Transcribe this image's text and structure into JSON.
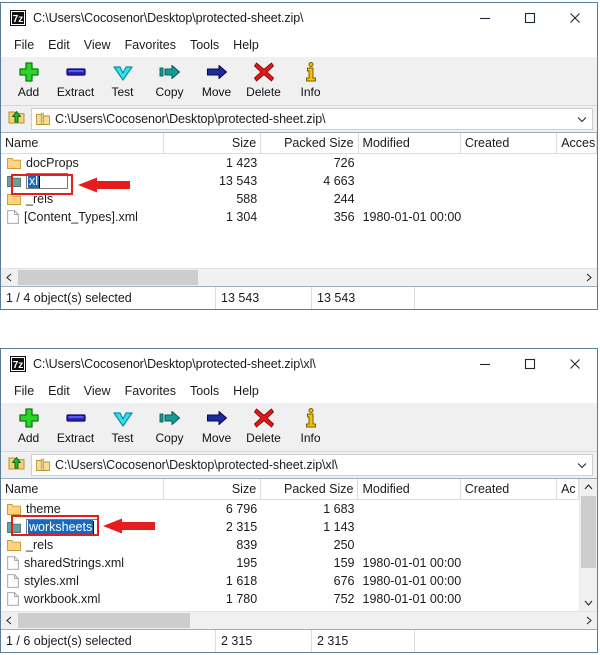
{
  "windows": [
    {
      "title": "C:\\Users\\Cocosenor\\Desktop\\protected-sheet.zip\\",
      "app_icon": "7zip-icon",
      "window_controls": {
        "minimize": "minimize-icon",
        "maximize": "maximize-icon",
        "close": "close-icon"
      },
      "menu": [
        "File",
        "Edit",
        "View",
        "Favorites",
        "Tools",
        "Help"
      ],
      "toolbar": [
        {
          "label": "Add",
          "icon": "plus-icon"
        },
        {
          "label": "Extract",
          "icon": "extract-icon"
        },
        {
          "label": "Test",
          "icon": "chevron-down-icon"
        },
        {
          "label": "Copy",
          "icon": "copy-arrow-icon"
        },
        {
          "label": "Move",
          "icon": "move-arrow-icon"
        },
        {
          "label": "Delete",
          "icon": "red-x-icon"
        },
        {
          "label": "Info",
          "icon": "info-icon"
        }
      ],
      "address": {
        "icon": "zip-folder-icon",
        "value": "C:\\Users\\Cocosenor\\Desktop\\protected-sheet.zip\\",
        "up_icon": "up-folder-icon",
        "dropdown_icon": "chevron-down-icon"
      },
      "columns": [
        "Name",
        "Size",
        "Packed Size",
        "Modified",
        "Created",
        "Acces"
      ],
      "rows": [
        {
          "icon": "folder-icon",
          "name": "docProps",
          "size": "1 423",
          "packed": "726",
          "modified": "",
          "created": "",
          "accessed": ""
        },
        {
          "icon": "folder-icon-selected",
          "name": "xl",
          "size": "13 543",
          "packed": "4 663",
          "modified": "",
          "created": "",
          "accessed": "",
          "renaming": true,
          "highlighted": true
        },
        {
          "icon": "folder-icon",
          "name": "_rels",
          "size": "588",
          "packed": "244",
          "modified": "",
          "created": "",
          "accessed": ""
        },
        {
          "icon": "file-icon",
          "name": "[Content_Types].xml",
          "size": "1 304",
          "packed": "356",
          "modified": "1980-01-01 00:00",
          "created": "",
          "accessed": ""
        }
      ],
      "status": [
        "1 / 4 object(s) selected",
        "13 543",
        "13 543",
        ""
      ],
      "has_vertical_scrollbar": false
    },
    {
      "title": "C:\\Users\\Cocosenor\\Desktop\\protected-sheet.zip\\xl\\",
      "app_icon": "7zip-icon",
      "window_controls": {
        "minimize": "minimize-icon",
        "maximize": "maximize-icon",
        "close": "close-icon"
      },
      "menu": [
        "File",
        "Edit",
        "View",
        "Favorites",
        "Tools",
        "Help"
      ],
      "toolbar": [
        {
          "label": "Add",
          "icon": "plus-icon"
        },
        {
          "label": "Extract",
          "icon": "extract-icon"
        },
        {
          "label": "Test",
          "icon": "chevron-down-icon"
        },
        {
          "label": "Copy",
          "icon": "copy-arrow-icon"
        },
        {
          "label": "Move",
          "icon": "move-arrow-icon"
        },
        {
          "label": "Delete",
          "icon": "red-x-icon"
        },
        {
          "label": "Info",
          "icon": "info-icon"
        }
      ],
      "address": {
        "icon": "zip-folder-icon",
        "value": "C:\\Users\\Cocosenor\\Desktop\\protected-sheet.zip\\xl\\",
        "up_icon": "up-folder-icon",
        "dropdown_icon": "chevron-down-icon"
      },
      "columns": [
        "Name",
        "Size",
        "Packed Size",
        "Modified",
        "Created",
        "Ac"
      ],
      "rows": [
        {
          "icon": "folder-icon",
          "name": "theme",
          "size": "6 796",
          "packed": "1 683",
          "modified": "",
          "created": "",
          "accessed": ""
        },
        {
          "icon": "folder-icon-selected",
          "name": "worksheets",
          "size": "2 315",
          "packed": "1 143",
          "modified": "",
          "created": "",
          "accessed": "",
          "renaming": true,
          "highlighted": true
        },
        {
          "icon": "folder-icon",
          "name": "_rels",
          "size": "839",
          "packed": "250",
          "modified": "",
          "created": "",
          "accessed": ""
        },
        {
          "icon": "file-icon",
          "name": "sharedStrings.xml",
          "size": "195",
          "packed": "159",
          "modified": "1980-01-01 00:00",
          "created": "",
          "accessed": ""
        },
        {
          "icon": "file-icon",
          "name": "styles.xml",
          "size": "1 618",
          "packed": "676",
          "modified": "1980-01-01 00:00",
          "created": "",
          "accessed": ""
        },
        {
          "icon": "file-icon",
          "name": "workbook.xml",
          "size": "1 780",
          "packed": "752",
          "modified": "1980-01-01 00:00",
          "created": "",
          "accessed": ""
        }
      ],
      "status": [
        "1 / 6 object(s) selected",
        "2 315",
        "2 315",
        ""
      ],
      "has_vertical_scrollbar": true
    }
  ],
  "colors": {
    "window_border": "#5b7c99",
    "toolbar_bg": "#f0f0f0",
    "highlight_red": "#e71c1c",
    "selection_blue": "#1669c1",
    "folder_yellow": "#ffcc66",
    "folder_selected_teal": "#6b9a96",
    "add_green": "#22b422",
    "extract_blue": "#2020c8",
    "test_cyan": "#14d2e6",
    "copy_teal": "#169c94",
    "move_navy": "#16208c",
    "delete_red": "#d81414",
    "info_yellow": "#f2c300"
  },
  "annotations": [
    {
      "type": "red-rectangle",
      "target": "xl-row"
    },
    {
      "type": "red-arrow",
      "direction": "left",
      "target": "xl-row"
    },
    {
      "type": "red-rectangle",
      "target": "worksheets-row"
    },
    {
      "type": "red-arrow",
      "direction": "left",
      "target": "worksheets-row"
    }
  ]
}
